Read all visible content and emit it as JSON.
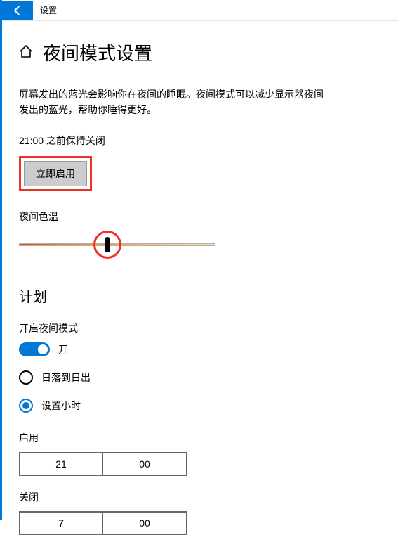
{
  "titlebar": {
    "label": "设置"
  },
  "header": {
    "title": "夜间模式设置"
  },
  "description": "屏幕发出的蓝光会影响你在夜间的睡眠。夜间模式可以减少显示器夜间发出的蓝光，帮助你睡得更好。",
  "status_text": "21:00 之前保持关闭",
  "enable_button": "立即启用",
  "color_temp": {
    "label": "夜间色温",
    "value_percent": 45
  },
  "schedule": {
    "heading": "计划",
    "toggle_label": "开启夜间模式",
    "toggle_state_label": "开",
    "toggle_on": true,
    "option_sunset": "日落到日出",
    "option_hours": "设置小时",
    "selected": "hours",
    "turn_on": {
      "label": "启用",
      "hour": "21",
      "minute": "00"
    },
    "turn_off": {
      "label": "关闭",
      "hour": "7",
      "minute": "00"
    }
  }
}
